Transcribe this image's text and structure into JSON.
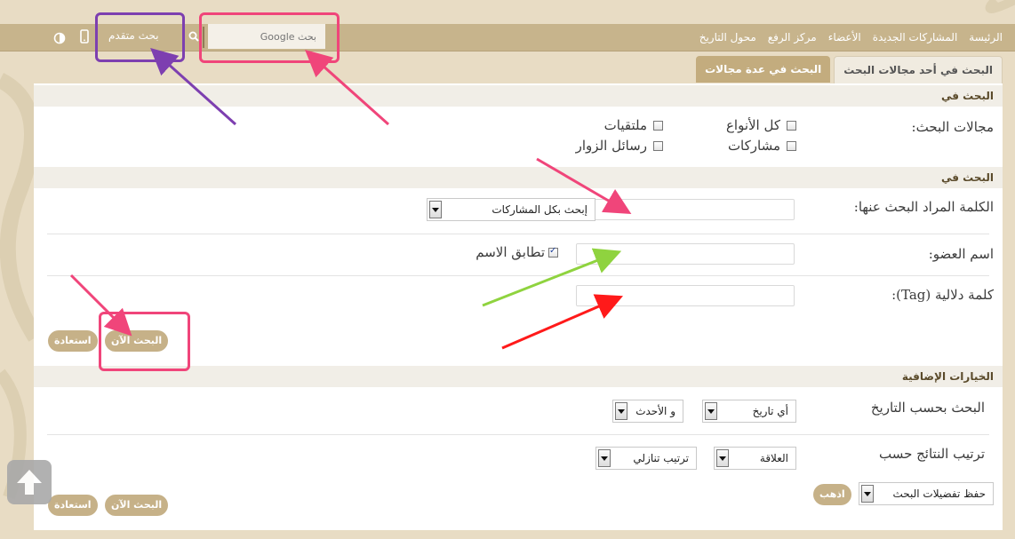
{
  "nav": {
    "items": [
      "الرئيسة",
      "المشاركات الجديدة",
      "الأعضاء",
      "مركز الرفع",
      "محول التاريخ"
    ],
    "search_placeholder": "بحث Google",
    "advanced_search": "بحث متقدم"
  },
  "tabs": [
    "البحث في أحد مجالات البحث",
    "البحث في عدة مجالات"
  ],
  "section1": {
    "header": "البحث في",
    "fields_label": "مجالات البحث:",
    "checkboxes": [
      {
        "label": "كل الأنواع",
        "checked": false
      },
      {
        "label": "مشاركات",
        "checked": false
      },
      {
        "label": "ملتقيات",
        "checked": false
      },
      {
        "label": "رسائل الزوار",
        "checked": false
      }
    ]
  },
  "section2": {
    "header": "البحث في",
    "keyword_label": "الكلمة المراد البحث عنها:",
    "keyword_scope": "إبحث بكل المشاركات",
    "member_label": "اسم العضو:",
    "exact_name": "تطابق الاسم",
    "exact_name_checked": true,
    "tag_label": "كلمة دلالية (Tag):",
    "search_now": "البحث الآن",
    "reset": "استعادة"
  },
  "section3": {
    "header": "الخيارات الإضافية",
    "date_label": "البحث بحسب التاريخ",
    "date_value": "أي تاريخ",
    "date_dir": "و الأحدث",
    "sort_label": "ترتيب النتائج حسب",
    "sort_value": "العلاقة",
    "sort_order": "ترتيب تنازلي",
    "save_prefs": "حفظ تفضيلات البحث",
    "go": "اذهب",
    "search_now": "البحث الآن",
    "reset": "استعادة"
  },
  "colors": {
    "topbar": "#c7b48c",
    "accent_button": "#c6b188",
    "highlight_pink": "#f0457a",
    "highlight_purple": "#7d3fb0",
    "arrow_green": "#8fd33f",
    "arrow_red": "#ff1a1a"
  }
}
